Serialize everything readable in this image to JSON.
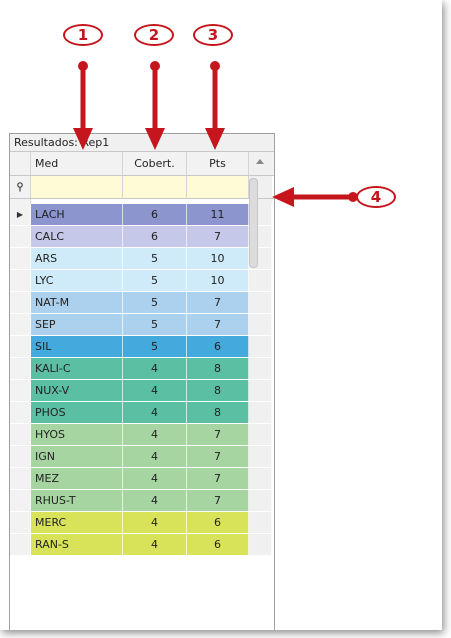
{
  "panel": {
    "title": "Resultados: Rep1"
  },
  "columns": {
    "med": "Med",
    "cob": "Cobert.",
    "pts": "Pts"
  },
  "filter": {
    "icon": "filter-pin-icon"
  },
  "callouts": [
    "1",
    "2",
    "3",
    "4"
  ],
  "colors": {
    "callout": "#c4161c",
    "filter_bg": "#fffbd7"
  },
  "rows": [
    {
      "med": "LACH",
      "cob": "6",
      "pts": "11",
      "color": "#8c95cd",
      "selected": true
    },
    {
      "med": "CALC",
      "cob": "6",
      "pts": "7",
      "color": "#c5c8e8"
    },
    {
      "med": "ARS",
      "cob": "5",
      "pts": "10",
      "color": "#cfeaf8"
    },
    {
      "med": "LYC",
      "cob": "5",
      "pts": "10",
      "color": "#cfeaf8"
    },
    {
      "med": "NAT-M",
      "cob": "5",
      "pts": "7",
      "color": "#acd1ef"
    },
    {
      "med": "SEP",
      "cob": "5",
      "pts": "7",
      "color": "#acd1ef"
    },
    {
      "med": "SIL",
      "cob": "5",
      "pts": "6",
      "color": "#44a9dc"
    },
    {
      "med": "KALI-C",
      "cob": "4",
      "pts": "8",
      "color": "#5bbfa4"
    },
    {
      "med": "NUX-V",
      "cob": "4",
      "pts": "8",
      "color": "#5bbfa4"
    },
    {
      "med": "PHOS",
      "cob": "4",
      "pts": "8",
      "color": "#5bbfa4"
    },
    {
      "med": "HYOS",
      "cob": "4",
      "pts": "7",
      "color": "#a6d5a2"
    },
    {
      "med": "IGN",
      "cob": "4",
      "pts": "7",
      "color": "#a6d5a2"
    },
    {
      "med": "MEZ",
      "cob": "4",
      "pts": "7",
      "color": "#a6d5a2"
    },
    {
      "med": "RHUS-T",
      "cob": "4",
      "pts": "7",
      "color": "#a6d5a2"
    },
    {
      "med": "MERC",
      "cob": "4",
      "pts": "6",
      "color": "#d8e35a"
    },
    {
      "med": "RAN-S",
      "cob": "4",
      "pts": "6",
      "color": "#d8e35a"
    }
  ]
}
